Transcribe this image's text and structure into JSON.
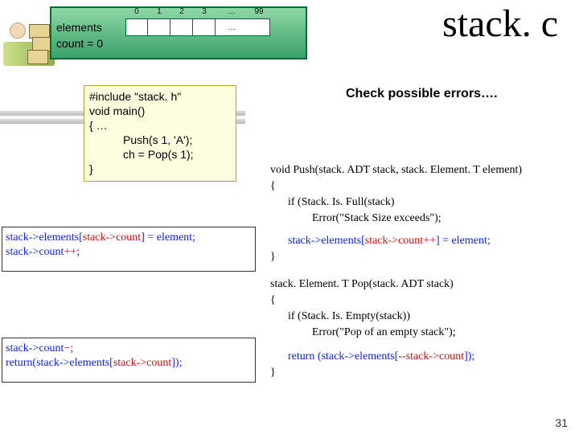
{
  "title": "stack. c",
  "array": {
    "label_elements": "elements",
    "label_count": "count = 0",
    "indices": [
      "0",
      "1",
      "2",
      "3"
    ],
    "dots": "…",
    "last_index": "99"
  },
  "main_code": {
    "l1": "#include \"stack. h\"",
    "l2": "void main()",
    "l3": "{     …",
    "l4": "Push(s 1, 'A');",
    "l5": "ch = Pop(s 1);",
    "l6": "}"
  },
  "check_label": "Check possible errors….",
  "explain_push": {
    "p1a": "stack->elements[",
    "p1b": "stack->count",
    "p1c": "] = element;",
    "p2a": "stack->count",
    "p2b": "++",
    "p2c": ";"
  },
  "explain_pop": {
    "p1a": "stack->count",
    "p1b": "−",
    "p1c": ";",
    "p2a": "return(stack->elements[",
    "p2b": "stack->count",
    "p2c": "]);"
  },
  "right_code": {
    "push_sig": "void Push(stack. ADT stack, stack. Element. T element)",
    "ob": "{",
    "push_if": "if (Stack. Is. Full(stack)",
    "push_err": "Error(\"Stack Size exceeds\");",
    "push_asg_a": "stack->elements[",
    "push_asg_b": "stack->count++",
    "push_asg_c": "] = element;",
    "cb": "}",
    "pop_sig": "stack. Element. T Pop(stack. ADT stack)",
    "pop_if": "if (Stack. Is. Empty(stack))",
    "pop_err": "Error(\"Pop of an empty stack\");",
    "pop_ret_a": "return (stack->elements[",
    "pop_ret_b": "--stack->count",
    "pop_ret_c": "]);"
  },
  "page_number": "31"
}
